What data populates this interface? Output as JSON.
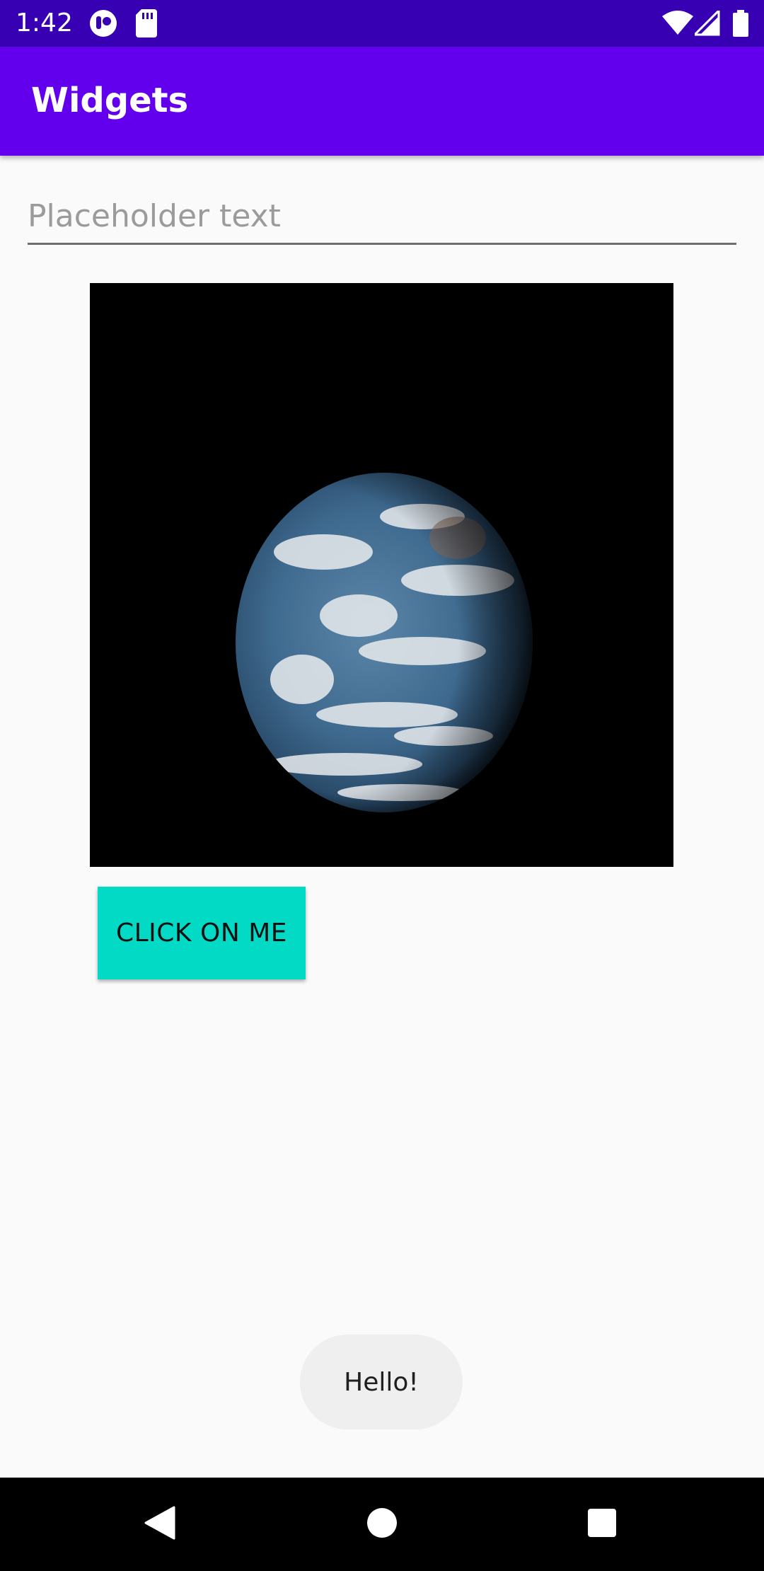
{
  "status_bar": {
    "time": "1:42",
    "icons": [
      "notification-app-icon",
      "sd-card-icon",
      "wifi-icon",
      "signal-icon",
      "battery-icon"
    ],
    "background": "#3700b3"
  },
  "app_bar": {
    "title": "Widgets",
    "background": "#6200ee"
  },
  "text_field": {
    "value": "",
    "placeholder": "Placeholder text"
  },
  "image": {
    "subject": "earth-image"
  },
  "button": {
    "label": "CLICK ON ME",
    "background": "#03dac5"
  },
  "toast": {
    "message": "Hello!"
  },
  "nav_bar": {
    "buttons": [
      "back-icon",
      "home-icon",
      "recents-icon"
    ]
  }
}
